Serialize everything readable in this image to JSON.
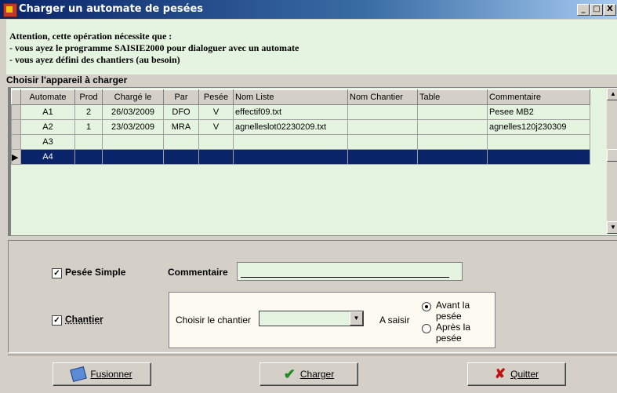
{
  "window": {
    "title": "Charger un automate de pesées",
    "controls": [
      "_",
      "□",
      "X"
    ]
  },
  "info": {
    "line1": "Attention, cette opération nécessite que :",
    "line2": "- vous ayez le programme SAISIE2000 pour dialoguer avec un automate",
    "line3": "- vous ayez défini des chantiers (au besoin)"
  },
  "grid": {
    "label": "Choisir l'appareil à charger",
    "columns": [
      "Automate",
      "Prod",
      "Chargé le",
      "Par",
      "Pesée",
      "Nom Liste",
      "Nom Chantier",
      "Table",
      "Commentaire"
    ],
    "rows": [
      {
        "automate": "A1",
        "prod": "2",
        "charge_le": "26/03/2009",
        "par": "DFO",
        "pesee": "V",
        "nom_liste": "effectif09.txt",
        "nom_chantier": "",
        "table": "",
        "commentaire": "Pesee MB2",
        "selected": false
      },
      {
        "automate": "A2",
        "prod": "1",
        "charge_le": "23/03/2009",
        "par": "MRA",
        "pesee": "V",
        "nom_liste": "agnelleslot02230209.txt",
        "nom_chantier": "",
        "table": "",
        "commentaire": "agnelles120j230309",
        "selected": false
      },
      {
        "automate": "A3",
        "prod": "",
        "charge_le": "",
        "par": "",
        "pesee": "",
        "nom_liste": "",
        "nom_chantier": "",
        "table": "",
        "commentaire": "",
        "selected": false
      },
      {
        "automate": "A4",
        "prod": "",
        "charge_le": "",
        "par": "",
        "pesee": "",
        "nom_liste": "",
        "nom_chantier": "",
        "table": "",
        "commentaire": "",
        "selected": true
      }
    ]
  },
  "options": {
    "pesee_simple": {
      "label": "Pesée Simple",
      "checked": true
    },
    "chantier": {
      "label": "Chantier",
      "checked": true
    },
    "commentaire_label": "Commentaire",
    "commentaire_value": "",
    "choisir_chantier_label": "Choisir le chantier",
    "chantier_value": "",
    "a_saisir_label": "A saisir",
    "radio_avant": {
      "label": "Avant la pesée",
      "checked": true
    },
    "radio_apres": {
      "label": "Après la pesée",
      "checked": false
    }
  },
  "buttons": {
    "fusionner": "Fusionner",
    "charger": "Charger",
    "quitter": "Quitter"
  },
  "colors": {
    "grid_bg": "#e4f4e0",
    "selection": "#0a246a",
    "title_bar": "#0a246a"
  }
}
